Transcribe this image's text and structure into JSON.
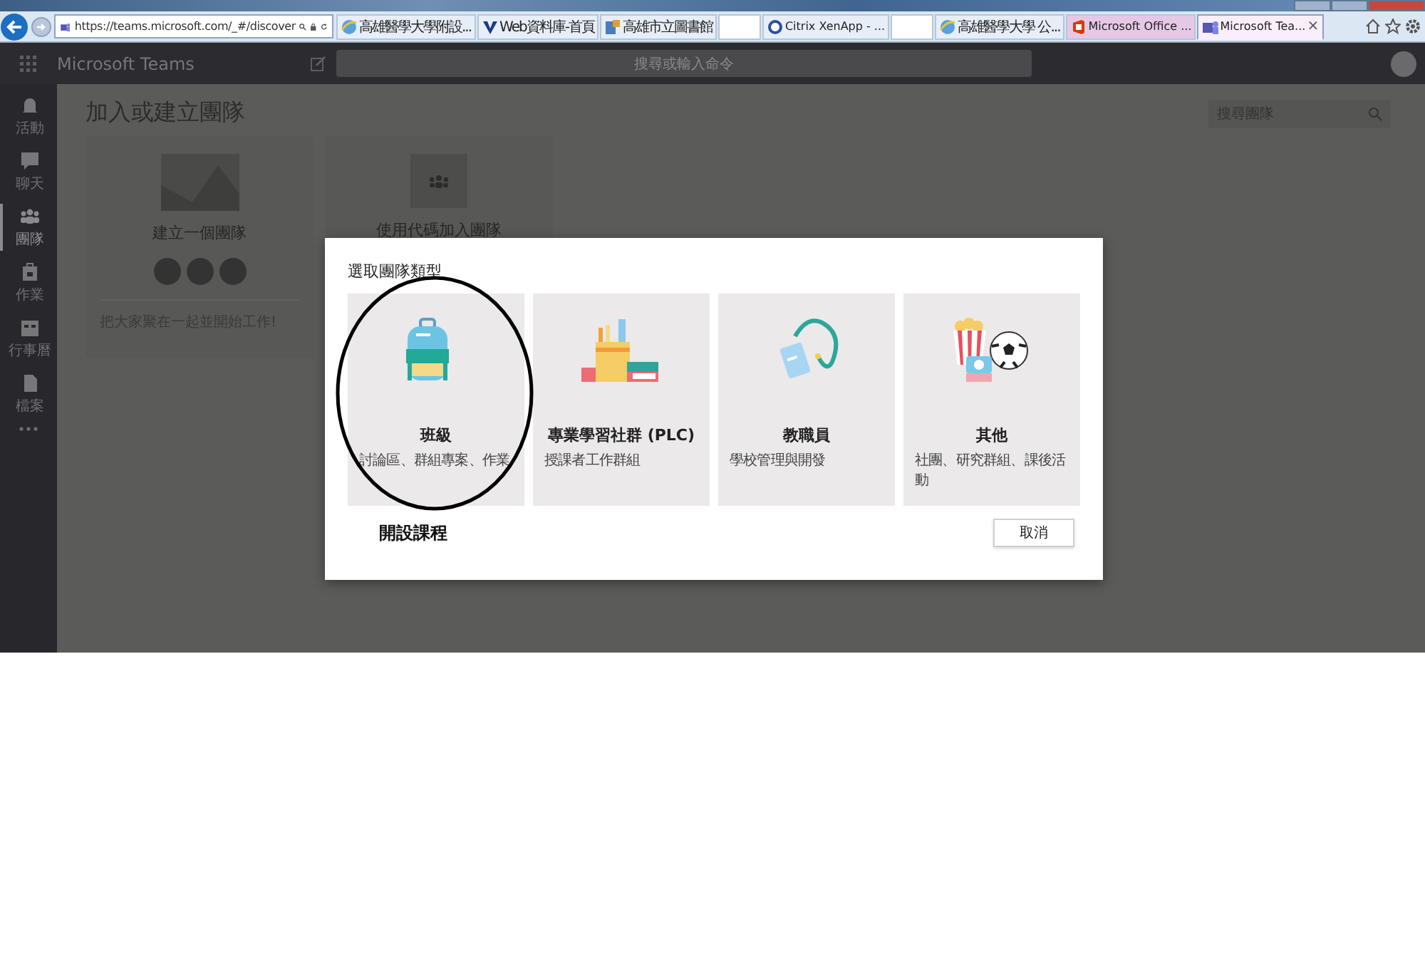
{
  "browser": {
    "address": "https://teams.microsoft.com/_#/discover",
    "tabs": [
      {
        "kind": "ie",
        "label": "高雄醫學大學附設...",
        "selected": false
      },
      {
        "kind": "v",
        "label": "Web資料庫-首頁",
        "selected": false
      },
      {
        "kind": "page",
        "label": "高雄市立圖書館",
        "selected": false
      },
      {
        "kind": "redacted",
        "selected": false
      },
      {
        "kind": "citrix",
        "label": "Citrix XenApp - ...",
        "selected": false
      },
      {
        "kind": "redacted",
        "selected": false
      },
      {
        "kind": "ie",
        "label": "高雄醫學大學 公...",
        "selected": false
      },
      {
        "kind": "office",
        "label": "Microsoft Office ...",
        "selected": false
      },
      {
        "kind": "teams",
        "label": "Microsoft Tea...",
        "selected": true,
        "close": "×"
      }
    ]
  },
  "app": {
    "name": "Microsoft Teams",
    "search_placeholder": "搜尋或輸入命令"
  },
  "rail": [
    {
      "kind": "bell",
      "label": "活動",
      "selected": false
    },
    {
      "kind": "chat",
      "label": "聊天",
      "selected": false
    },
    {
      "kind": "team",
      "label": "團隊",
      "selected": true
    },
    {
      "kind": "bag",
      "label": "作業",
      "selected": false
    },
    {
      "kind": "calendar",
      "label": "行事曆",
      "selected": false
    },
    {
      "kind": "file",
      "label": "檔案",
      "selected": false
    }
  ],
  "page": {
    "title": "加入或建立團隊",
    "search_placeholder": "搜尋團隊",
    "cards": [
      {
        "kind": "create",
        "title": "建立一個團隊",
        "caption": "把大家聚在一起並開始工作!"
      },
      {
        "kind": "join",
        "title": "使用代碼加入團隊"
      }
    ]
  },
  "dialog": {
    "title": "選取團隊類型",
    "options": [
      {
        "kind": "class",
        "name": "班級",
        "description": "討論區、群組專案、作業"
      },
      {
        "kind": "plc",
        "name": "專業學習社群 (PLC)",
        "description": "授課者工作群組"
      },
      {
        "kind": "staff",
        "name": "教職員",
        "description": "學校管理與開發"
      },
      {
        "kind": "other",
        "name": "其他",
        "description": "社團、研究群組、課後活動"
      }
    ],
    "annotation": "開設課程",
    "cancel": "取消"
  }
}
